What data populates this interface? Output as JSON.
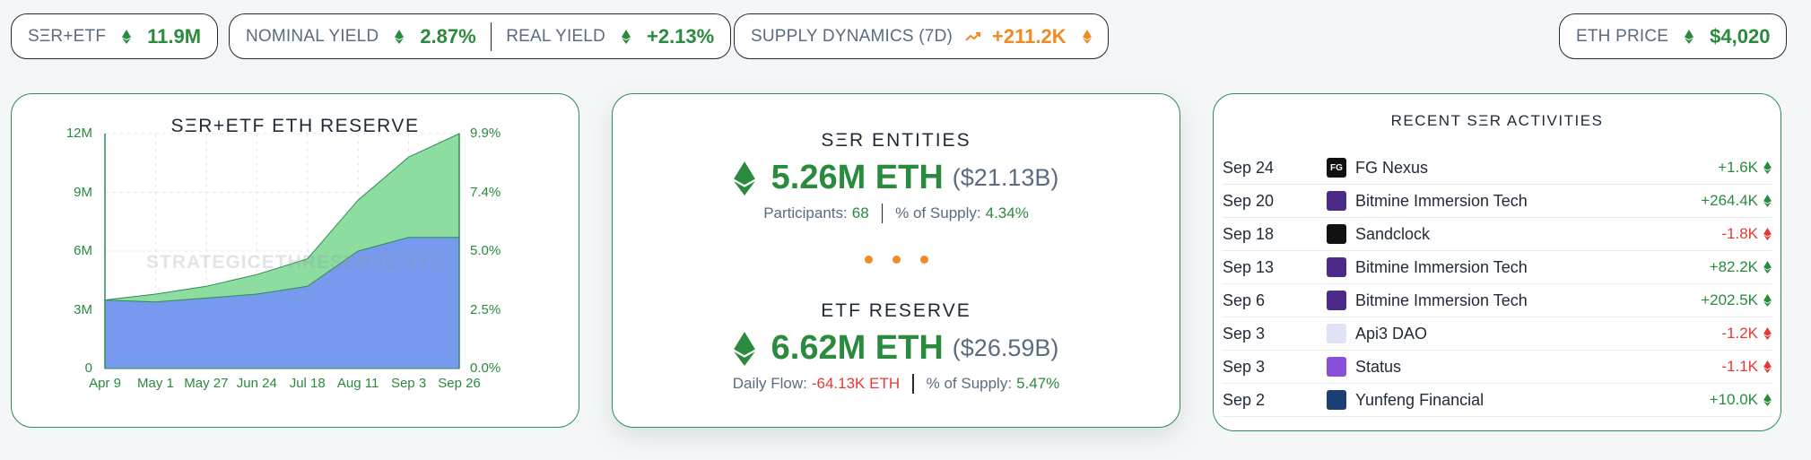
{
  "top": {
    "ser_etf": {
      "label": "SΞR+ETF",
      "value": "11.9M"
    },
    "yield": {
      "nominal_label": "NOMINAL YIELD",
      "nominal_value": "2.87%",
      "real_label": "REAL YIELD",
      "real_value": "+2.13%"
    },
    "supply": {
      "label": "SUPPLY DYNAMICS (7D)",
      "value": "+211.2K"
    },
    "price": {
      "label": "ETH PRICE",
      "value": "$4,020"
    }
  },
  "chart": {
    "watermark": "STRATEGICETHRESERVE.XYZ",
    "y_left_ticks": [
      "12M",
      "9M",
      "6M",
      "3M",
      "0"
    ],
    "y_right_ticks": [
      "9.9%",
      "7.4%",
      "5.0%",
      "2.5%",
      "0.0%"
    ],
    "colors": {
      "total": "#8ddca0",
      "ser": "#7799ee",
      "line": "#2e8b57"
    }
  },
  "chart_data": {
    "type": "area",
    "title": "SΞR+ETF ETH RESERVE",
    "x": [
      "Apr 9",
      "May 1",
      "May 27",
      "Jun 24",
      "Jul 18",
      "Aug 11",
      "Sep 3",
      "Sep 26"
    ],
    "ylim": [
      0,
      12
    ],
    "y2lim": [
      0,
      9.9
    ],
    "series": [
      {
        "values": [
          3.5,
          3.8,
          4.2,
          4.8,
          5.6,
          8.6,
          10.8,
          12.0
        ]
      },
      {
        "values": [
          3.5,
          3.4,
          3.6,
          3.8,
          4.2,
          6.0,
          6.7,
          6.7
        ]
      }
    ]
  },
  "center": {
    "ser_title": "SΞR ENTITIES",
    "ser_eth": "5.26M ETH",
    "ser_usd": "($21.13B)",
    "participants_label": "Participants:",
    "participants_value": "68",
    "ser_supply_label": "% of Supply:",
    "ser_supply_value": "4.34%",
    "etf_title": "ETF RESERVE",
    "etf_eth": "6.62M ETH",
    "etf_usd": "($26.59B)",
    "flow_label": "Daily Flow:",
    "flow_value": "-64.13K ETH",
    "etf_supply_label": "% of Supply:",
    "etf_supply_value": "5.47%"
  },
  "activity": {
    "title": "RECENT SΞR ACTIVITIES",
    "rows": [
      {
        "date": "Sep 24",
        "name": "FG Nexus",
        "amount": "+1.6K",
        "logo_text": "FG",
        "logo_color": "#111111",
        "positive": true
      },
      {
        "date": "Sep 20",
        "name": "Bitmine Immersion Tech",
        "amount": "+264.4K",
        "logo_text": "",
        "logo_color": "#4b2a8a",
        "positive": true
      },
      {
        "date": "Sep 18",
        "name": "Sandclock",
        "amount": "-1.8K",
        "logo_text": "",
        "logo_color": "#111111",
        "positive": false
      },
      {
        "date": "Sep 13",
        "name": "Bitmine Immersion Tech",
        "amount": "+82.2K",
        "logo_text": "",
        "logo_color": "#4b2a8a",
        "positive": true
      },
      {
        "date": "Sep 6",
        "name": "Bitmine Immersion Tech",
        "amount": "+202.5K",
        "logo_text": "",
        "logo_color": "#4b2a8a",
        "positive": true
      },
      {
        "date": "Sep 3",
        "name": "Api3 DAO",
        "amount": "-1.2K",
        "logo_text": "",
        "logo_color": "#dfe3f5",
        "positive": false
      },
      {
        "date": "Sep 3",
        "name": "Status",
        "amount": "-1.1K",
        "logo_text": "",
        "logo_color": "#8a4fd8",
        "positive": false
      },
      {
        "date": "Sep 2",
        "name": "Yunfeng Financial",
        "amount": "+10.0K",
        "logo_text": "",
        "logo_color": "#1c3f73",
        "positive": true
      }
    ]
  }
}
